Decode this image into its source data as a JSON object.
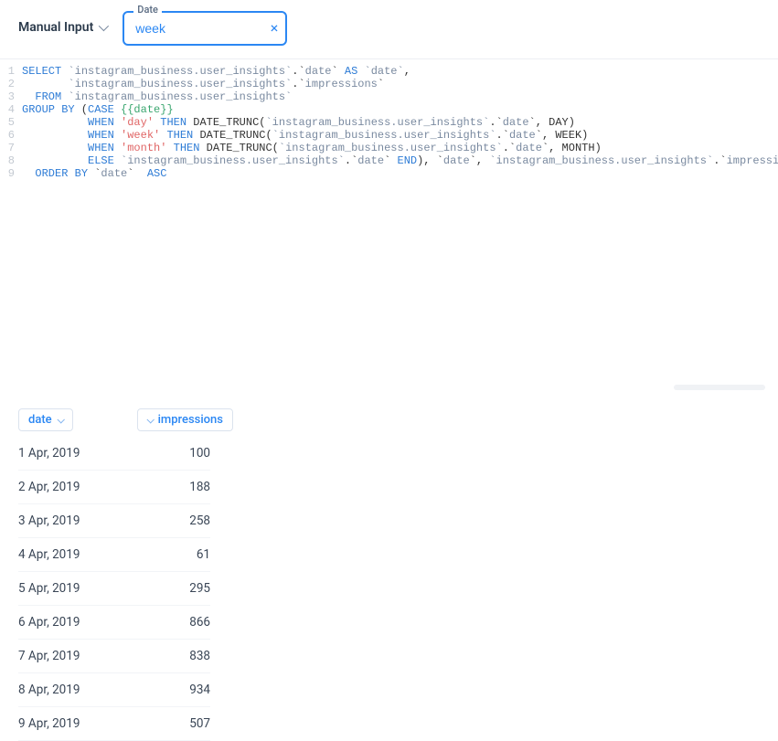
{
  "toolbar": {
    "dropdown_label": "Manual Input",
    "input_label": "Date",
    "input_value": "week"
  },
  "editor": {
    "lines": [
      {
        "n": "1",
        "segs": [
          [
            "kw",
            "SELECT "
          ],
          [
            "ident",
            "`instagram_business.user_insights`"
          ],
          [
            "",
            ".`"
          ],
          [
            "ident",
            "date"
          ],
          [
            "",
            "` "
          ],
          [
            "kw",
            "AS"
          ],
          [
            "",
            ""
          ],
          [
            "ident",
            " `date`"
          ],
          [
            "",
            ","
          ]
        ]
      },
      {
        "n": "2",
        "segs": [
          [
            "",
            "       "
          ],
          [
            "ident",
            "`instagram_business.user_insights`"
          ],
          [
            "",
            ".`"
          ],
          [
            "ident",
            "impressions"
          ],
          [
            "",
            "`"
          ]
        ]
      },
      {
        "n": "3",
        "segs": [
          [
            "",
            "  "
          ],
          [
            "kw",
            "FROM "
          ],
          [
            "ident",
            "`instagram_business.user_insights`"
          ]
        ]
      },
      {
        "n": "4",
        "segs": [
          [
            "kw",
            "GROUP BY"
          ],
          [
            "",
            ""
          ],
          [
            "",
            ""
          ],
          [
            "",
            " ("
          ],
          [
            "kw",
            "CASE "
          ],
          [
            "tmpl",
            "{{date}}"
          ]
        ]
      },
      {
        "n": "5",
        "segs": [
          [
            "",
            "          "
          ],
          [
            "kw",
            "WHEN "
          ],
          [
            "str",
            "'day'"
          ],
          [
            "",
            ""
          ],
          [
            "",
            " "
          ],
          [
            "kw",
            "THEN"
          ],
          [
            "",
            ""
          ],
          [
            "",
            " DATE_TRUNC("
          ],
          [
            "ident",
            "`instagram_business.user_insights`"
          ],
          [
            "",
            ".`"
          ],
          [
            "ident",
            "date"
          ],
          [
            "",
            "`, DAY)"
          ]
        ]
      },
      {
        "n": "6",
        "segs": [
          [
            "",
            "          "
          ],
          [
            "kw",
            "WHEN "
          ],
          [
            "str",
            "'week'"
          ],
          [
            "",
            ""
          ],
          [
            "",
            " "
          ],
          [
            "kw",
            "THEN"
          ],
          [
            "",
            ""
          ],
          [
            "",
            " DATE_TRUNC("
          ],
          [
            "ident",
            "`instagram_business.user_insights`"
          ],
          [
            "",
            ".`"
          ],
          [
            "ident",
            "date"
          ],
          [
            "",
            "`, WEEK)"
          ]
        ]
      },
      {
        "n": "7",
        "segs": [
          [
            "",
            "          "
          ],
          [
            "kw",
            "WHEN "
          ],
          [
            "str",
            "'month'"
          ],
          [
            "",
            ""
          ],
          [
            "",
            " "
          ],
          [
            "kw",
            "THEN"
          ],
          [
            "",
            ""
          ],
          [
            "",
            " DATE_TRUNC("
          ],
          [
            "ident",
            "`instagram_business.user_insights`"
          ],
          [
            "",
            ".`"
          ],
          [
            "ident",
            "date"
          ],
          [
            "",
            "`, MONTH)"
          ]
        ]
      },
      {
        "n": "8",
        "segs": [
          [
            "",
            "          "
          ],
          [
            "kw",
            "ELSE "
          ],
          [
            "ident",
            "`instagram_business.user_insights`"
          ],
          [
            "",
            ".`"
          ],
          [
            "ident",
            "date"
          ],
          [
            "",
            "` "
          ],
          [
            "kw",
            "END"
          ],
          [
            "",
            "), `"
          ],
          [
            "ident",
            "date"
          ],
          [
            "",
            "`, "
          ],
          [
            "ident",
            "`instagram_business.user_insights`"
          ],
          [
            "",
            ".`"
          ],
          [
            "ident",
            "impressions"
          ],
          [
            "",
            "`"
          ]
        ]
      },
      {
        "n": "9",
        "segs": [
          [
            "",
            "  "
          ],
          [
            "kw",
            "ORDER BY"
          ],
          [
            "",
            ""
          ],
          [
            "",
            " `"
          ],
          [
            "ident",
            "date"
          ],
          [
            "",
            "` "
          ],
          [
            "kw",
            " ASC"
          ]
        ]
      }
    ]
  },
  "results": {
    "columns": {
      "date": "date",
      "impressions": "impressions"
    },
    "rows": [
      {
        "date": "1 Apr, 2019",
        "impressions": "100"
      },
      {
        "date": "2 Apr, 2019",
        "impressions": "188"
      },
      {
        "date": "3 Apr, 2019",
        "impressions": "258"
      },
      {
        "date": "4 Apr, 2019",
        "impressions": "61"
      },
      {
        "date": "5 Apr, 2019",
        "impressions": "295"
      },
      {
        "date": "6 Apr, 2019",
        "impressions": "866"
      },
      {
        "date": "7 Apr, 2019",
        "impressions": "838"
      },
      {
        "date": "8 Apr, 2019",
        "impressions": "934"
      },
      {
        "date": "9 Apr, 2019",
        "impressions": "507"
      }
    ]
  },
  "chart_data": {
    "type": "table",
    "columns": [
      "date",
      "impressions"
    ],
    "rows": [
      [
        "1 Apr, 2019",
        100
      ],
      [
        "2 Apr, 2019",
        188
      ],
      [
        "3 Apr, 2019",
        258
      ],
      [
        "4 Apr, 2019",
        61
      ],
      [
        "5 Apr, 2019",
        295
      ],
      [
        "6 Apr, 2019",
        866
      ],
      [
        "7 Apr, 2019",
        838
      ],
      [
        "8 Apr, 2019",
        934
      ],
      [
        "9 Apr, 2019",
        507
      ]
    ]
  }
}
